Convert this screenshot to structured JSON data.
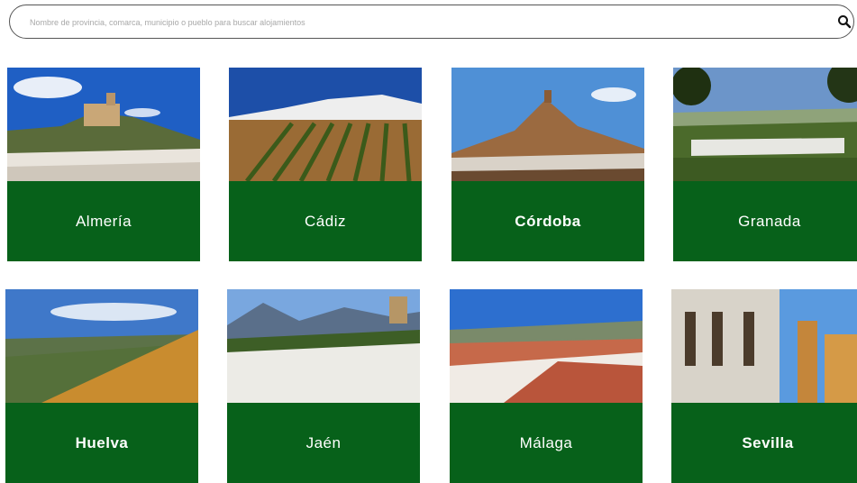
{
  "search": {
    "placeholder": "Nombre de provincia, comarca, municipio o pueblo para buscar alojamientos",
    "icon": "search-icon"
  },
  "provinces": [
    {
      "name": "Almería",
      "bold": false,
      "photo": "castle-hill-village-icon"
    },
    {
      "name": "Cádiz",
      "bold": false,
      "photo": "white-village-olive-fields-icon"
    },
    {
      "name": "Córdoba",
      "bold": true,
      "photo": "castle-peak-town-icon"
    },
    {
      "name": "Granada",
      "bold": false,
      "photo": "valley-village-trees-icon"
    },
    {
      "name": "Huelva",
      "bold": true,
      "photo": "golden-hillside-icon"
    },
    {
      "name": "Jaén",
      "bold": false,
      "photo": "white-town-mountains-icon"
    },
    {
      "name": "Málaga",
      "bold": false,
      "photo": "rooftops-valley-icon"
    },
    {
      "name": "Sevilla",
      "bold": true,
      "photo": "historic-street-tower-icon"
    }
  ],
  "colors": {
    "label_band": "#07611a",
    "label_text": "#ffffff",
    "search_border": "#555555"
  }
}
